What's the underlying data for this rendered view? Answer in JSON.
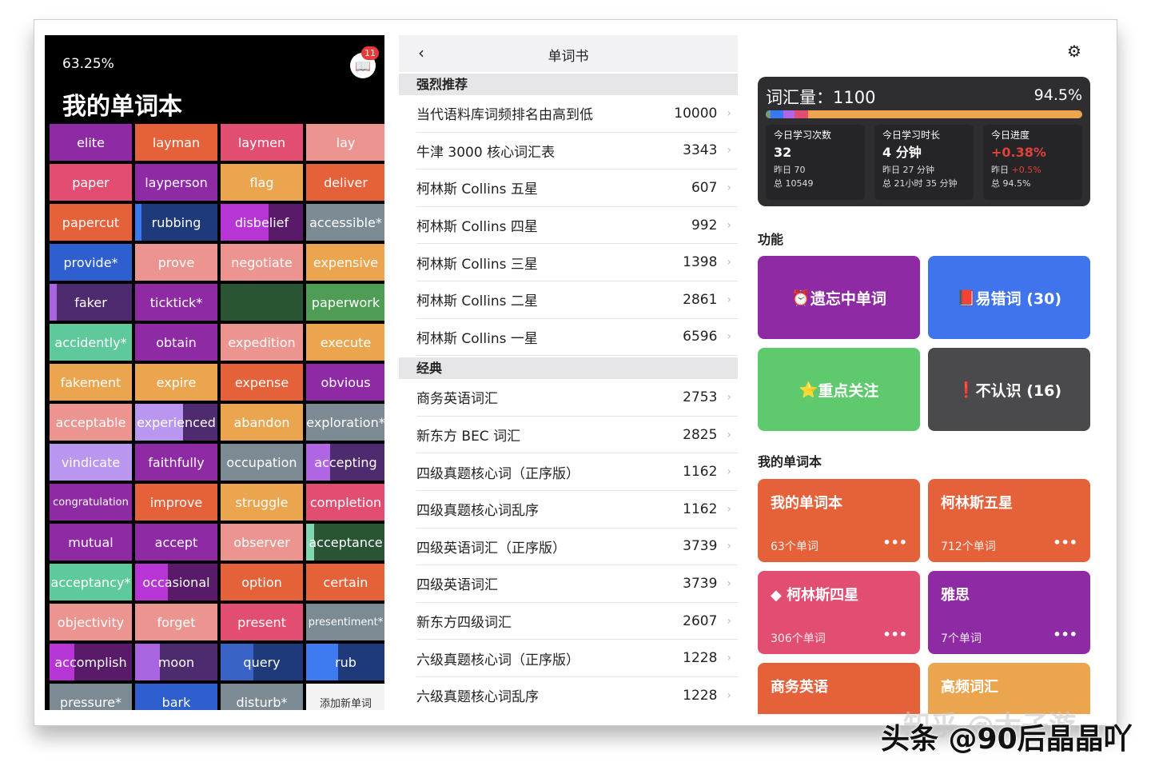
{
  "left": {
    "percent": "63.25%",
    "title": "我的单词本",
    "badge": "11",
    "colors": {
      "purple": "#8e2aa3",
      "orange": "#e5613a",
      "pink": "#e24e72",
      "lightpink": "#ec9490",
      "peach": "#eca54f",
      "darkblue": "#1f3a7a",
      "blue": "#2f5fcf",
      "gray": "#7b8a93",
      "darkgreen": "#2a5535",
      "green": "#4f9c55",
      "mint": "#5ec99a",
      "lavender": "#b996f0",
      "darkpurple": "#4e2a6e",
      "plum": "#5a1a6a",
      "white": "#f3f3f3"
    },
    "words": [
      {
        "w": "elite",
        "bg": "purple"
      },
      {
        "w": "layman",
        "bg": "orange"
      },
      {
        "w": "laymen",
        "bg": "pink"
      },
      {
        "w": "lay",
        "bg": "lightpink"
      },
      {
        "w": "paper",
        "bg": "pink"
      },
      {
        "w": "layperson",
        "bg": "purple"
      },
      {
        "w": "flag",
        "bg": "peach"
      },
      {
        "w": "deliver",
        "bg": "orange"
      },
      {
        "w": "papercut",
        "bg": "orange"
      },
      {
        "w": "rubbing",
        "bg": "darkblue",
        "p": 0.08,
        "pc": "#3a78ef"
      },
      {
        "w": "disbelief",
        "bg": "plum",
        "p": 0.58,
        "pc": "#b735d4"
      },
      {
        "w": "accessible*",
        "bg": "gray"
      },
      {
        "w": "provide*",
        "bg": "blue"
      },
      {
        "w": "prove",
        "bg": "lightpink"
      },
      {
        "w": "negotiate",
        "bg": "lightpink"
      },
      {
        "w": "expensive",
        "bg": "peach"
      },
      {
        "w": "faker",
        "bg": "darkpurple",
        "p": 0.09,
        "pc": "#a965e0"
      },
      {
        "w": "ticktick*",
        "bg": "purple"
      },
      {
        "w": "",
        "bg": "darkgreen"
      },
      {
        "w": "paperwork",
        "bg": "green"
      },
      {
        "w": "accidently*",
        "bg": "mint"
      },
      {
        "w": "obtain",
        "bg": "purple"
      },
      {
        "w": "expedition",
        "bg": "lightpink"
      },
      {
        "w": "execute",
        "bg": "peach"
      },
      {
        "w": "fakement",
        "bg": "peach"
      },
      {
        "w": "expire",
        "bg": "peach"
      },
      {
        "w": "expense",
        "bg": "orange"
      },
      {
        "w": "obvious",
        "bg": "purple"
      },
      {
        "w": "acceptable",
        "bg": "lightpink"
      },
      {
        "w": "experienced",
        "bg": "darkpurple",
        "p": 0.58,
        "pc": "#b996f0"
      },
      {
        "w": "abandon",
        "bg": "peach"
      },
      {
        "w": "exploration*",
        "bg": "gray"
      },
      {
        "w": "vindicate",
        "bg": "lavender"
      },
      {
        "w": "faithfully",
        "bg": "purple"
      },
      {
        "w": "occupation",
        "bg": "gray"
      },
      {
        "w": "accepting",
        "bg": "darkpurple",
        "p": 0.3,
        "pc": "#b065e5"
      },
      {
        "w": "congratulation",
        "bg": "purple",
        "small": true
      },
      {
        "w": "improve",
        "bg": "orange"
      },
      {
        "w": "struggle",
        "bg": "peach"
      },
      {
        "w": "completion",
        "bg": "pink"
      },
      {
        "w": "mutual",
        "bg": "purple"
      },
      {
        "w": "accept",
        "bg": "purple"
      },
      {
        "w": "observer",
        "bg": "lightpink"
      },
      {
        "w": "acceptance",
        "bg": "darkgreen",
        "p": 0.1,
        "pc": "#7fd6b0"
      },
      {
        "w": "acceptancy*",
        "bg": "mint"
      },
      {
        "w": "occasional",
        "bg": "plum",
        "p": 0.4,
        "pc": "#b735d4"
      },
      {
        "w": "option",
        "bg": "orange"
      },
      {
        "w": "certain",
        "bg": "orange"
      },
      {
        "w": "objectivity",
        "bg": "lightpink"
      },
      {
        "w": "forget",
        "bg": "lightpink"
      },
      {
        "w": "present",
        "bg": "pink"
      },
      {
        "w": "presentiment*",
        "bg": "gray",
        "small": true
      },
      {
        "w": "accomplish",
        "bg": "plum",
        "p": 0.3,
        "pc": "#b735d4"
      },
      {
        "w": "moon",
        "bg": "darkpurple",
        "p": 0.3,
        "pc": "#a965e0"
      },
      {
        "w": "query",
        "bg": "darkblue",
        "p": 0.4,
        "pc": "#3a63c8"
      },
      {
        "w": "rub",
        "bg": "darkblue",
        "p": 0.4,
        "pc": "#3e7af0"
      },
      {
        "w": "pressure*",
        "bg": "gray"
      },
      {
        "w": "bark",
        "bg": "blue"
      },
      {
        "w": "disturb*",
        "bg": "gray"
      },
      {
        "w": "添加新单词",
        "bg": "white",
        "dark": true,
        "small": true
      }
    ]
  },
  "middle": {
    "back": "‹",
    "title": "单词书",
    "sections": [
      {
        "name": "强烈推荐",
        "rows": [
          [
            "当代语料库词频排名由高到低",
            "10000"
          ],
          [
            "牛津 3000 核心词汇表",
            "3343"
          ],
          [
            "柯林斯 Collins 五星",
            "607"
          ],
          [
            "柯林斯 Collins 四星",
            "992"
          ],
          [
            "柯林斯 Collins 三星",
            "1398"
          ],
          [
            "柯林斯 Collins 二星",
            "2861"
          ],
          [
            "柯林斯 Collins 一星",
            "6596"
          ]
        ]
      },
      {
        "name": "经典",
        "rows": [
          [
            "商务英语词汇",
            "2753"
          ],
          [
            "新东方 BEC 词汇",
            "2825"
          ],
          [
            "四级真题核心词（正序版）",
            "1162"
          ],
          [
            "四级真题核心词乱序",
            "1162"
          ],
          [
            "四级英语词汇（正序版）",
            "3739"
          ],
          [
            "四级英语词汇",
            "3739"
          ],
          [
            "新东方四级词汇",
            "2607"
          ],
          [
            "六级真题核心词（正序版）",
            "1228"
          ],
          [
            "六级真题核心词乱序",
            "1228"
          ]
        ]
      }
    ]
  },
  "right": {
    "stats": {
      "vocab": "词汇量：1100",
      "percent": "94.5%",
      "progress": 0.945,
      "bar_segments": [
        {
          "c": "#6f9a8a",
          "f": 0.015
        },
        {
          "c": "#3a78ef",
          "f": 0.04
        },
        {
          "c": "#b065e5",
          "f": 0.035
        },
        {
          "c": "#e24e72",
          "f": 0.045
        }
      ],
      "boxes": [
        {
          "label": "今日学习次数",
          "value": "32",
          "y_label": "昨日",
          "y_value": "70",
          "total": "总 10549"
        },
        {
          "label": "今日学习时长",
          "value": "4 分钟",
          "y_label": "昨日",
          "y_value": "27 分钟",
          "total": "总 21小时 35 分钟"
        },
        {
          "label": "今日进度",
          "value": "+0.38%",
          "y_label": "昨日",
          "y_value": "+0.5%",
          "total": "总 94.5%",
          "red": true
        }
      ]
    },
    "func_title": "功能",
    "functions": [
      {
        "icon": "⏰",
        "label": "遗忘中单词",
        "color": "#8e2aa3"
      },
      {
        "icon": "📕",
        "label": "易错词 (30)",
        "color": "#3f74ec"
      },
      {
        "icon": "⭐",
        "label": "重点关注",
        "color": "#5fc96d"
      },
      {
        "icon": "❗",
        "label": "不认识 (16)",
        "color": "#4a4a4c"
      }
    ],
    "books_title": "我的单词本",
    "books": [
      {
        "title": "我的单词本",
        "count": "63个单词",
        "color": "#e5613a"
      },
      {
        "title": "柯林斯五星",
        "count": "712个单词",
        "color": "#e5613a"
      },
      {
        "title": "◆ 柯林斯四星",
        "count": "306个单词",
        "color": "#e24e72"
      },
      {
        "title": "雅思",
        "count": "7个单词",
        "color": "#8e2aa3"
      },
      {
        "title": "商务英语",
        "count": "",
        "color": "#e5613a"
      },
      {
        "title": "高频词汇",
        "count": "",
        "color": "#eca54f"
      }
    ],
    "dots": "•••"
  },
  "watermark": {
    "a": "知乎 @大子游",
    "b": "头条 @90后晶晶吖"
  }
}
